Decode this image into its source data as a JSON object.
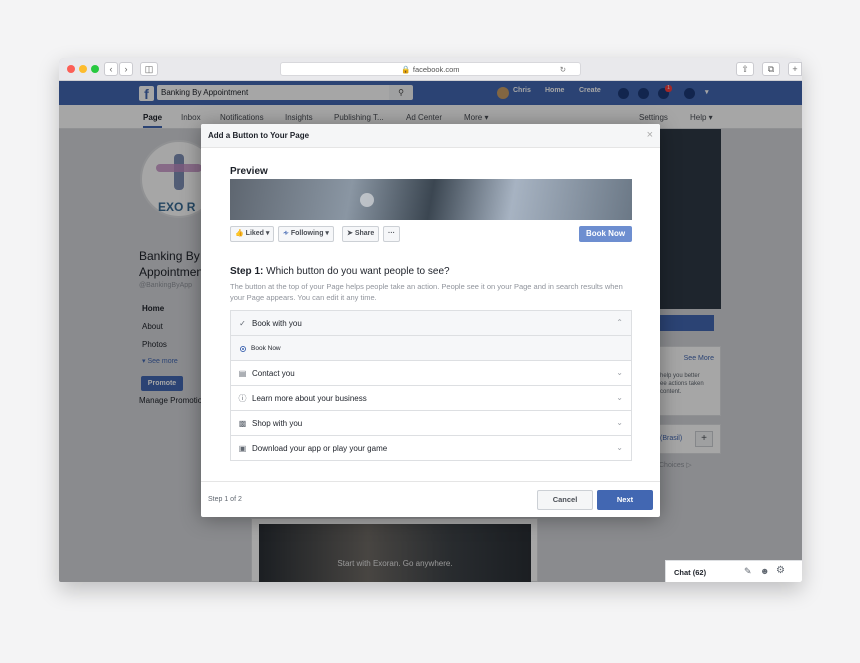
{
  "browser": {
    "url": "facebook.com",
    "lock_icon": "lock-icon"
  },
  "fb": {
    "search_value": "Banking By Appointment",
    "user_name": "Chris",
    "nav_home": "Home",
    "nav_create": "Create",
    "notification_count": "1"
  },
  "tabs": [
    "Page",
    "Inbox",
    "Notifications",
    "Insights",
    "Publishing T...",
    "Ad Center",
    "More ▾",
    "Settings",
    "Help ▾"
  ],
  "page": {
    "name_line1": "Banking By",
    "name_line2": "Appointmen",
    "handle": "@BankingByApp",
    "logo_text": "EXO",
    "logo_text2": "R",
    "nav": [
      "Home",
      "About",
      "Photos",
      "▾ See more"
    ],
    "promote": "Promote",
    "manage": "Manage Promotio",
    "banner_text": "Start with Exoran. Go anywhere.",
    "right_see_more": "See More",
    "right_text": "help you better\nee actions taken\ncontent.",
    "right_lang": "(Brasil)",
    "right_choices": "Choices ▷",
    "chat": "Chat (62)"
  },
  "modal": {
    "title": "Add a Button to Your Page",
    "close": "×",
    "preview_label": "Preview",
    "preview_buttons": {
      "liked": "Liked ▾",
      "following": "Following ▾",
      "share": "Share",
      "more": "···"
    },
    "preview_cta": "Book Now",
    "step_bold": "Step 1:",
    "step_question": "Which button do you want people to see?",
    "step_desc": "The button at the top of your Page helps people take an action. People see it on your Page and in search results when your Page appears. You can edit it any time.",
    "options": [
      {
        "label": "Book with you",
        "icon": "check-icon",
        "expanded": true
      },
      {
        "label": "Contact you",
        "icon": "message-icon"
      },
      {
        "label": "Learn more about your business",
        "icon": "info-icon"
      },
      {
        "label": "Shop with you",
        "icon": "shopping-bag-icon"
      },
      {
        "label": "Download your app or play your game",
        "icon": "app-icon"
      }
    ],
    "sub_option": "Book Now",
    "step_count": "Step 1 of 2",
    "cancel": "Cancel",
    "next": "Next"
  },
  "colors": {
    "fb_blue": "#4267b2",
    "cta_blue": "#6d8ed0"
  }
}
